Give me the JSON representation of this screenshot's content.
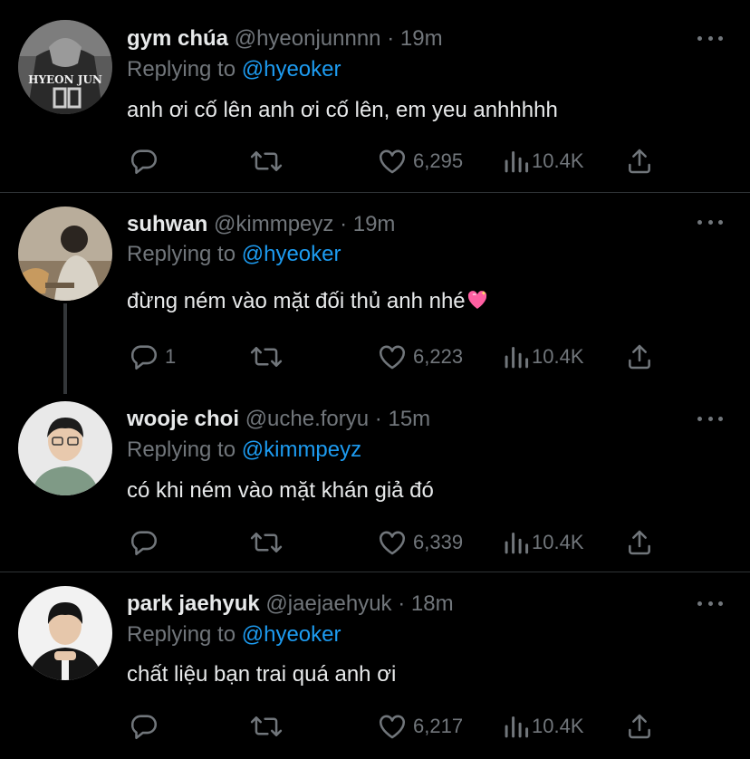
{
  "colors": {
    "background": "#000000",
    "text": "#e7e9ea",
    "muted": "#71767b",
    "link": "#1d9bf0",
    "divider": "#2f3336"
  },
  "reply_prefix": "Replying to",
  "tweets": [
    {
      "name": "gym chúa",
      "handle": "@hyeonjunnnn",
      "dot": "·",
      "time": "19m",
      "replying_to": "@hyeoker",
      "text": "anh ơi cố lên anh ơi cố lên, em yeu anhhhhh",
      "avatar_text": "HYEON JUN",
      "reply_count": "",
      "likes": "6,295",
      "views": "10.4K"
    },
    {
      "name": "suhwan",
      "handle": "@kimmpeyz",
      "dot": "·",
      "time": "19m",
      "replying_to": "@hyeoker",
      "text": "đừng ném vào mặt đối thủ anh nhé",
      "emoji_icon": "sparkling-heart-icon",
      "reply_count": "1",
      "likes": "6,223",
      "views": "10.4K"
    },
    {
      "name": "wooje choi",
      "handle": "@uche.foryu",
      "dot": "·",
      "time": "15m",
      "replying_to": "@kimmpeyz",
      "text": "có khi ném vào mặt khán giả đó",
      "reply_count": "",
      "likes": "6,339",
      "views": "10.4K"
    },
    {
      "name": "park jaehyuk",
      "handle": "@jaejaehyuk",
      "dot": "·",
      "time": "18m",
      "replying_to": "@hyeoker",
      "text": "chất liệu bạn trai quá anh ơi",
      "reply_count": "",
      "likes": "6,217",
      "views": "10.4K"
    }
  ],
  "icons": {
    "reply": "reply-icon",
    "retweet": "retweet-icon",
    "like": "heart-icon",
    "views": "views-icon",
    "share": "share-icon",
    "more": "more-icon"
  }
}
